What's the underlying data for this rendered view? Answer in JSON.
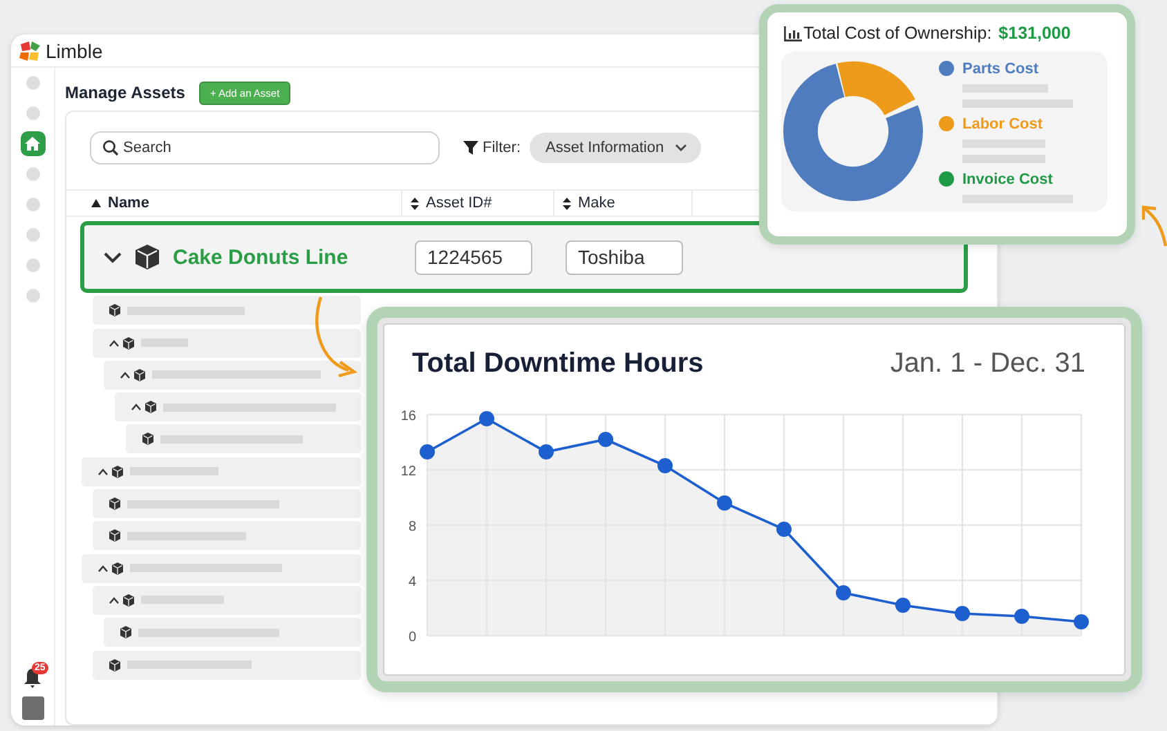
{
  "app": {
    "logo": "Limble"
  },
  "sidebar": {
    "items": [
      {
        "kind": "dot",
        "selected": false
      },
      {
        "kind": "dot",
        "selected": false
      },
      {
        "kind": "home",
        "selected": true
      },
      {
        "kind": "dot",
        "selected": false
      },
      {
        "kind": "dot",
        "selected": false
      },
      {
        "kind": "dot",
        "selected": false
      },
      {
        "kind": "dot",
        "selected": false
      },
      {
        "kind": "dot",
        "selected": false
      }
    ],
    "notifications": "25"
  },
  "page": {
    "title": "Manage Assets",
    "add_button": "+ Add an Asset"
  },
  "search": {
    "placeholder": "Search"
  },
  "filter": {
    "label": "Filter:",
    "value": "Asset Information"
  },
  "table": {
    "columns": [
      {
        "label": "Name",
        "sorted": true
      },
      {
        "label": "Asset ID#",
        "sorted": false
      },
      {
        "label": "Make",
        "sorted": false
      }
    ]
  },
  "tree": [
    {
      "kind": "asset",
      "name": "Cake Donuts Line",
      "asset_id": "1224565",
      "make": "Toshiba",
      "selected": true,
      "expanded": true,
      "children": [
        {
          "kind": "placeholder"
        },
        {
          "kind": "placeholder",
          "expanded": true,
          "children": [
            {
              "kind": "placeholder",
              "expanded": true,
              "children": [
                {
                  "kind": "placeholder",
                  "expanded": true,
                  "children": [
                    {
                      "kind": "placeholder"
                    }
                  ]
                }
              ]
            }
          ]
        }
      ]
    },
    {
      "kind": "placeholder",
      "expanded": true,
      "children": [
        {
          "kind": "placeholder"
        },
        {
          "kind": "placeholder"
        }
      ]
    },
    {
      "kind": "placeholder",
      "expanded": true,
      "children": [
        {
          "kind": "placeholder",
          "expanded": true,
          "children": [
            {
              "kind": "placeholder"
            }
          ]
        },
        {
          "kind": "placeholder"
        }
      ]
    }
  ],
  "cost": {
    "title": "Total Cost of Ownership:",
    "total": "$131,000",
    "legend": [
      {
        "label": "Parts Cost",
        "color": "#4f7cbf"
      },
      {
        "label": "Labor Cost",
        "color": "#ee9a1a"
      },
      {
        "label": "Invoice Cost",
        "color": "#1e9a46"
      }
    ]
  },
  "downtime": {
    "title": "Total Downtime Hours",
    "date_range": "Jan. 1 - Dec. 31",
    "chart_data": {
      "type": "area",
      "grid": true,
      "categories": [
        null,
        null,
        null,
        null,
        null,
        null,
        null,
        null,
        null,
        null,
        null,
        null
      ],
      "ylim": [
        0,
        16
      ],
      "yticks": [
        0,
        4,
        8,
        12,
        16
      ],
      "series": [
        {
          "color": "#1d5fce",
          "values": [
            13.3,
            15.7,
            13.3,
            14.2,
            12.3,
            9.6,
            7.7,
            3.1,
            2.2,
            1.6,
            1.4,
            1.0
          ]
        }
      ]
    }
  }
}
